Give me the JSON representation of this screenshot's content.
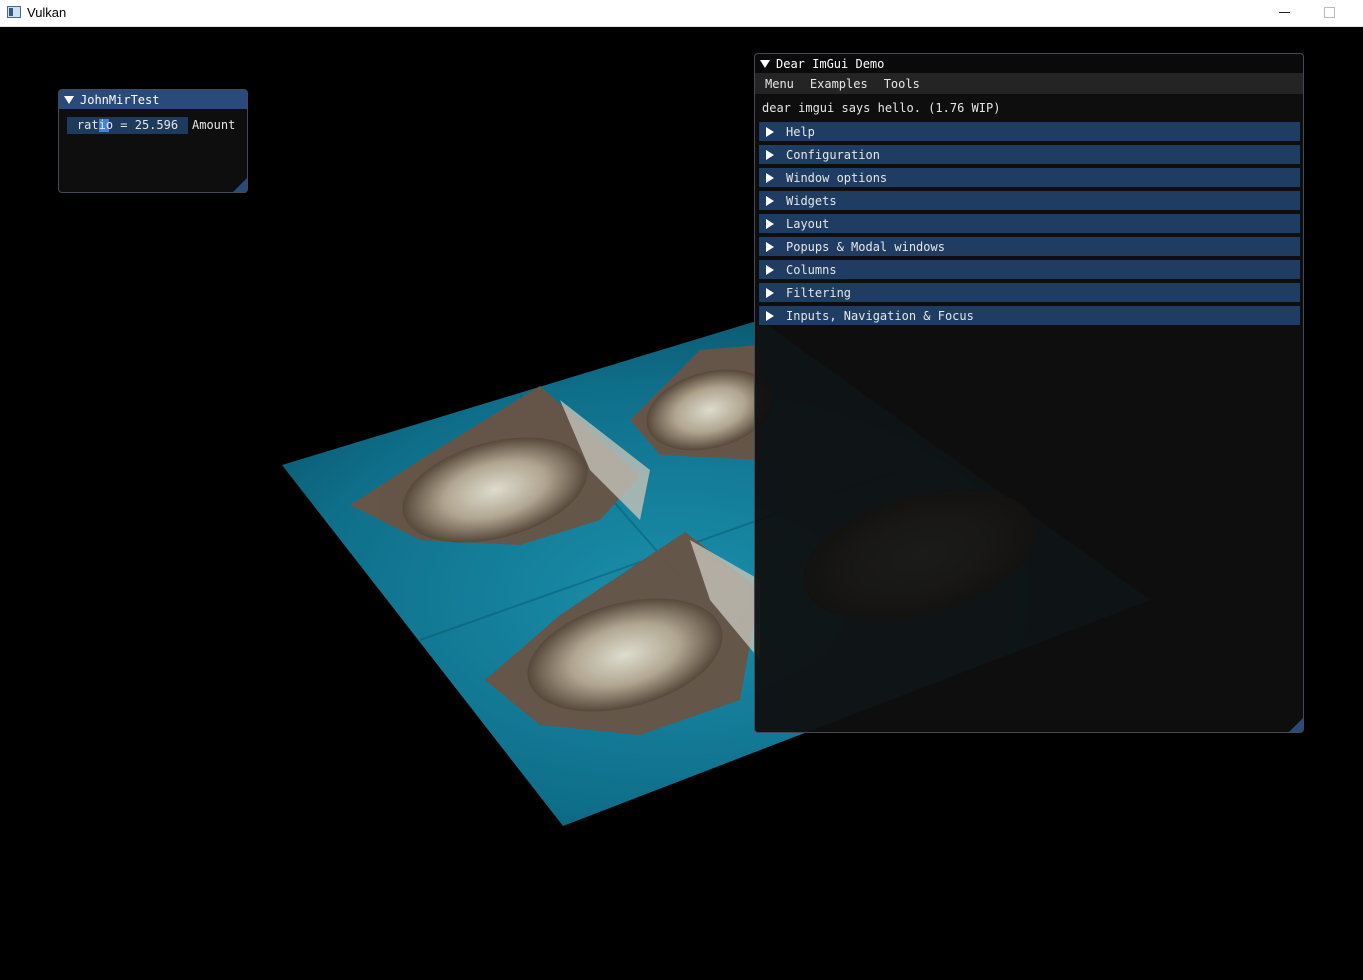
{
  "os_window": {
    "title": "Vulkan"
  },
  "john_window": {
    "title": "JohnMirTest",
    "slider_text": "ratio = 25.596",
    "slider_label": "Amount",
    "ratio_value": 25.596
  },
  "demo_window": {
    "title": "Dear ImGui Demo",
    "menus": [
      "Menu",
      "Examples",
      "Tools"
    ],
    "hello_text": "dear imgui says hello. (1.76 WIP)",
    "headers": [
      "Help",
      "Configuration",
      "Window options",
      "Widgets",
      "Layout",
      "Popups & Modal windows",
      "Columns",
      "Filtering",
      "Inputs, Navigation & Focus"
    ]
  },
  "colors": {
    "title_active": "#294a7a",
    "header": "#1f3d63",
    "slider_grab": "#3d85e0",
    "plane_teal": "#0f6f8a"
  },
  "icons": [
    "app-icon",
    "minimize-icon",
    "maximize-icon",
    "collapse-arrow-icon",
    "expand-arrow-icon",
    "resize-grip-icon"
  ]
}
